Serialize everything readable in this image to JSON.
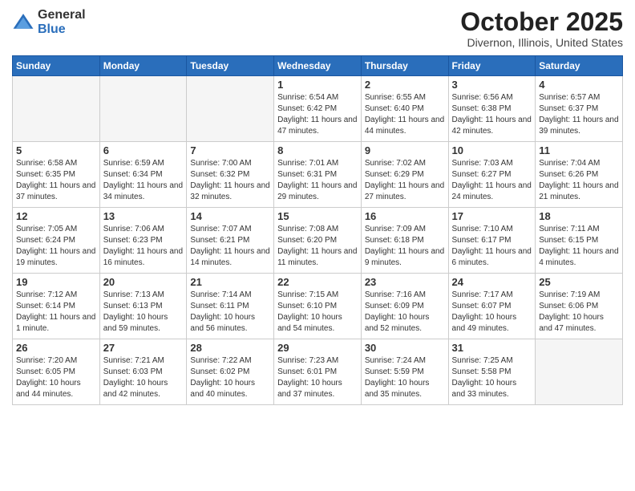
{
  "header": {
    "logo_general": "General",
    "logo_blue": "Blue",
    "month_title": "October 2025",
    "location": "Divernon, Illinois, United States"
  },
  "columns": [
    "Sunday",
    "Monday",
    "Tuesday",
    "Wednesday",
    "Thursday",
    "Friday",
    "Saturday"
  ],
  "weeks": [
    [
      {
        "day": "",
        "info": ""
      },
      {
        "day": "",
        "info": ""
      },
      {
        "day": "",
        "info": ""
      },
      {
        "day": "1",
        "info": "Sunrise: 6:54 AM\nSunset: 6:42 PM\nDaylight: 11 hours and 47 minutes."
      },
      {
        "day": "2",
        "info": "Sunrise: 6:55 AM\nSunset: 6:40 PM\nDaylight: 11 hours and 44 minutes."
      },
      {
        "day": "3",
        "info": "Sunrise: 6:56 AM\nSunset: 6:38 PM\nDaylight: 11 hours and 42 minutes."
      },
      {
        "day": "4",
        "info": "Sunrise: 6:57 AM\nSunset: 6:37 PM\nDaylight: 11 hours and 39 minutes."
      }
    ],
    [
      {
        "day": "5",
        "info": "Sunrise: 6:58 AM\nSunset: 6:35 PM\nDaylight: 11 hours and 37 minutes."
      },
      {
        "day": "6",
        "info": "Sunrise: 6:59 AM\nSunset: 6:34 PM\nDaylight: 11 hours and 34 minutes."
      },
      {
        "day": "7",
        "info": "Sunrise: 7:00 AM\nSunset: 6:32 PM\nDaylight: 11 hours and 32 minutes."
      },
      {
        "day": "8",
        "info": "Sunrise: 7:01 AM\nSunset: 6:31 PM\nDaylight: 11 hours and 29 minutes."
      },
      {
        "day": "9",
        "info": "Sunrise: 7:02 AM\nSunset: 6:29 PM\nDaylight: 11 hours and 27 minutes."
      },
      {
        "day": "10",
        "info": "Sunrise: 7:03 AM\nSunset: 6:27 PM\nDaylight: 11 hours and 24 minutes."
      },
      {
        "day": "11",
        "info": "Sunrise: 7:04 AM\nSunset: 6:26 PM\nDaylight: 11 hours and 21 minutes."
      }
    ],
    [
      {
        "day": "12",
        "info": "Sunrise: 7:05 AM\nSunset: 6:24 PM\nDaylight: 11 hours and 19 minutes."
      },
      {
        "day": "13",
        "info": "Sunrise: 7:06 AM\nSunset: 6:23 PM\nDaylight: 11 hours and 16 minutes."
      },
      {
        "day": "14",
        "info": "Sunrise: 7:07 AM\nSunset: 6:21 PM\nDaylight: 11 hours and 14 minutes."
      },
      {
        "day": "15",
        "info": "Sunrise: 7:08 AM\nSunset: 6:20 PM\nDaylight: 11 hours and 11 minutes."
      },
      {
        "day": "16",
        "info": "Sunrise: 7:09 AM\nSunset: 6:18 PM\nDaylight: 11 hours and 9 minutes."
      },
      {
        "day": "17",
        "info": "Sunrise: 7:10 AM\nSunset: 6:17 PM\nDaylight: 11 hours and 6 minutes."
      },
      {
        "day": "18",
        "info": "Sunrise: 7:11 AM\nSunset: 6:15 PM\nDaylight: 11 hours and 4 minutes."
      }
    ],
    [
      {
        "day": "19",
        "info": "Sunrise: 7:12 AM\nSunset: 6:14 PM\nDaylight: 11 hours and 1 minute."
      },
      {
        "day": "20",
        "info": "Sunrise: 7:13 AM\nSunset: 6:13 PM\nDaylight: 10 hours and 59 minutes."
      },
      {
        "day": "21",
        "info": "Sunrise: 7:14 AM\nSunset: 6:11 PM\nDaylight: 10 hours and 56 minutes."
      },
      {
        "day": "22",
        "info": "Sunrise: 7:15 AM\nSunset: 6:10 PM\nDaylight: 10 hours and 54 minutes."
      },
      {
        "day": "23",
        "info": "Sunrise: 7:16 AM\nSunset: 6:09 PM\nDaylight: 10 hours and 52 minutes."
      },
      {
        "day": "24",
        "info": "Sunrise: 7:17 AM\nSunset: 6:07 PM\nDaylight: 10 hours and 49 minutes."
      },
      {
        "day": "25",
        "info": "Sunrise: 7:19 AM\nSunset: 6:06 PM\nDaylight: 10 hours and 47 minutes."
      }
    ],
    [
      {
        "day": "26",
        "info": "Sunrise: 7:20 AM\nSunset: 6:05 PM\nDaylight: 10 hours and 44 minutes."
      },
      {
        "day": "27",
        "info": "Sunrise: 7:21 AM\nSunset: 6:03 PM\nDaylight: 10 hours and 42 minutes."
      },
      {
        "day": "28",
        "info": "Sunrise: 7:22 AM\nSunset: 6:02 PM\nDaylight: 10 hours and 40 minutes."
      },
      {
        "day": "29",
        "info": "Sunrise: 7:23 AM\nSunset: 6:01 PM\nDaylight: 10 hours and 37 minutes."
      },
      {
        "day": "30",
        "info": "Sunrise: 7:24 AM\nSunset: 5:59 PM\nDaylight: 10 hours and 35 minutes."
      },
      {
        "day": "31",
        "info": "Sunrise: 7:25 AM\nSunset: 5:58 PM\nDaylight: 10 hours and 33 minutes."
      },
      {
        "day": "",
        "info": ""
      }
    ]
  ]
}
